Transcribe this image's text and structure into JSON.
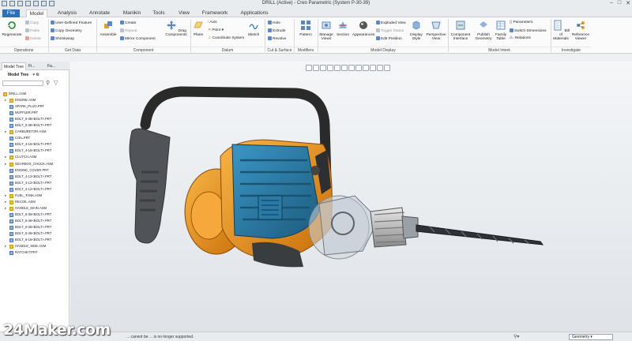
{
  "window": {
    "title": "DRILL (Active) - Creo Parametric (System P-30-39)"
  },
  "tabs": [
    "File",
    "Model",
    "Analysis",
    "Annotate",
    "Manikin",
    "Tools",
    "View",
    "Framework",
    "Applications"
  ],
  "ribbon": {
    "operations": {
      "regenerate": "Regenerate",
      "copy": "Copy",
      "paste": "Paste",
      "delete": "Delete",
      "group": "Operations"
    },
    "get_data": {
      "udf": "User-Defined Feature",
      "copy_geometry": "Copy Geometry",
      "shrinkwrap": "Shrinkwrap",
      "group": "Get Data"
    },
    "component": {
      "assemble": "Assemble",
      "create": "Create",
      "repeat": "Repeat",
      "mirror": "Mirror Component",
      "drag": "Drag Components",
      "group": "Component"
    },
    "datum": {
      "plane": "Plane",
      "axis": "Axis",
      "point": "Point",
      "csys": "Coordinate System",
      "sketch": "Sketch",
      "group": "Datum"
    },
    "cut_surface": {
      "hole": "Hole",
      "extrude": "Extrude",
      "revolve": "Revolve",
      "group": "Cut & Surface"
    },
    "modifiers": {
      "pattern": "Pattern",
      "group": "Modifiers"
    },
    "model_display": {
      "manage_views": "Manage Views",
      "section": "Section",
      "appearances": "Appearances",
      "exploded": "Exploded View",
      "toggle_status": "Toggle Status",
      "edit_position": "Edit Position",
      "display_style": "Display Style",
      "perspective": "Perspective View",
      "group": "Model Display"
    },
    "model_intent": {
      "component_interface": "Component Interface",
      "publish_geometry": "Publish Geometry",
      "family_table": "Family Table",
      "parameters": "Parameters",
      "switch_dimensions": "Switch Dimensions",
      "relations": "Relations",
      "group": "Model Intent"
    },
    "investigate": {
      "bom": "Bill of Materials",
      "reference_viewer": "Reference Viewer",
      "group": "Investigate"
    }
  },
  "left_panel": {
    "tabs": [
      "Model Tree",
      "Fi...",
      "Fa..."
    ],
    "header": "Model Tree",
    "tree": [
      {
        "label": "DRILL.ASM",
        "root": true,
        "type": "asm"
      },
      {
        "label": "ENGINE.ASM",
        "type": "asm",
        "exp": true
      },
      {
        "label": "SPARK_PLUG.PRT",
        "type": "part"
      },
      {
        "label": "MUFFLER.PRT",
        "type": "part"
      },
      {
        "label": "BOLT_5-38<BOLT>.PRT",
        "type": "part"
      },
      {
        "label": "BOLT_5-38<BOLT>.PRT",
        "type": "part"
      },
      {
        "label": "CARBURETOR.ASM",
        "type": "asm",
        "exp": true
      },
      {
        "label": "COIL.PRT",
        "type": "part"
      },
      {
        "label": "BOLT_4-16<BOLT>.PRT",
        "type": "part"
      },
      {
        "label": "BOLT_4-16<BOLT>.PRT",
        "type": "part"
      },
      {
        "label": "CLUTCH.ASM",
        "type": "asm",
        "exp": true
      },
      {
        "label": "GEARBOX_CHUCK.ASM",
        "type": "asm",
        "exp": true
      },
      {
        "label": "ENGINE_COVER.PRT",
        "type": "part"
      },
      {
        "label": "BOLT_4-12<BOLT>.PRT",
        "type": "part"
      },
      {
        "label": "BOLT_4-12<BOLT>.PRT",
        "type": "part"
      },
      {
        "label": "BOLT_4-12<BOLT>.PRT",
        "type": "part"
      },
      {
        "label": "FUEL_TANK.ASM",
        "type": "asm",
        "exp": true
      },
      {
        "label": "RECOIL.ASM",
        "type": "asm",
        "exp": true
      },
      {
        "label": "HANDLE_MAIN.ASM",
        "type": "asm",
        "exp": true
      },
      {
        "label": "BOLT_6-36<BOLT>.PRT",
        "type": "part"
      },
      {
        "label": "BOLT_6-36<BOLT>.PRT",
        "type": "part"
      },
      {
        "label": "BOLT_6-36<BOLT>.PRT",
        "type": "part"
      },
      {
        "label": "BOLT_6-36<BOLT>.PRT",
        "type": "part"
      },
      {
        "label": "BOLT_6-16<BOLT>.PRT",
        "type": "part"
      },
      {
        "label": "HANDLE_SIDE.ASM",
        "type": "asm",
        "exp": true
      },
      {
        "label": "RATCHET.PRT",
        "type": "part"
      }
    ]
  },
  "status": {
    "message": "... cannot be ... is no longer supported.",
    "filter": "Geometry"
  },
  "watermark": "24Maker.com",
  "colors": {
    "accent": "#2f6fb5",
    "engine_orange": "#f29a1e",
    "engine_teal": "#2c7fa8"
  }
}
